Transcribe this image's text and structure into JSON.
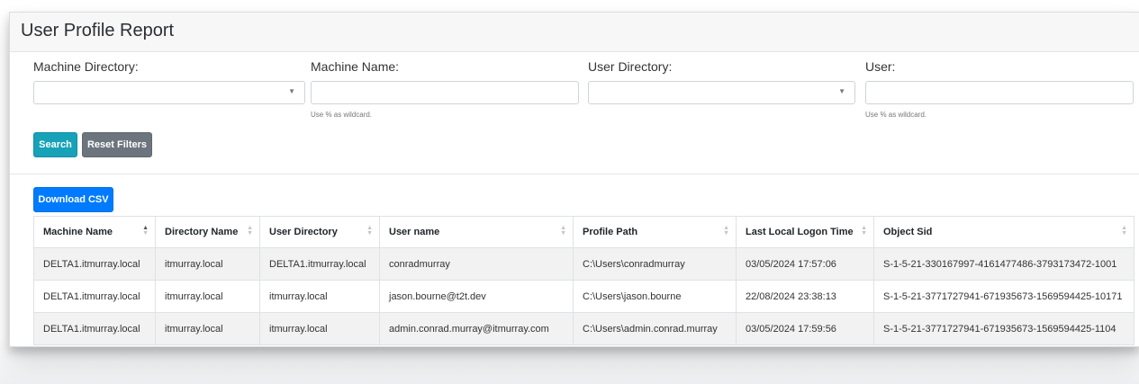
{
  "page": {
    "title": "User Profile Report"
  },
  "filters": {
    "machine_directory": {
      "label": "Machine Directory:",
      "value": ""
    },
    "machine_name": {
      "label": "Machine Name:",
      "value": "",
      "placeholder": "",
      "hint": "Use % as wildcard."
    },
    "user_directory": {
      "label": "User Directory:",
      "value": ""
    },
    "user": {
      "label": "User:",
      "value": "",
      "placeholder": "",
      "hint": "Use % as wildcard."
    }
  },
  "buttons": {
    "search": "Search",
    "reset": "Reset Filters",
    "download": "Download CSV"
  },
  "table": {
    "columns": [
      "Machine Name",
      "Directory Name",
      "User Directory",
      "User name",
      "Profile Path",
      "Last Local Logon Time",
      "Object Sid"
    ],
    "sorted_column": "Machine Name",
    "sort_direction": "ascending",
    "rows": [
      [
        "DELTA1.itmurray.local",
        "itmurray.local",
        "DELTA1.itmurray.local",
        "conradmurray",
        "C:\\Users\\conradmurray",
        "03/05/2024 17:57:06",
        "S-1-5-21-330167997-4161477486-3793173472-1001"
      ],
      [
        "DELTA1.itmurray.local",
        "itmurray.local",
        "itmurray.local",
        "jason.bourne@t2t.dev",
        "C:\\Users\\jason.bourne",
        "22/08/2024 23:38:13",
        "S-1-5-21-3771727941-671935673-1569594425-10171"
      ],
      [
        "DELTA1.itmurray.local",
        "itmurray.local",
        "itmurray.local",
        "admin.conrad.murray@itmurray.com",
        "C:\\Users\\admin.conrad.murray",
        "03/05/2024 17:59:56",
        "S-1-5-21-3771727941-671935673-1569594425-1104"
      ]
    ]
  },
  "colors": {
    "search_button": "#17a2b8",
    "reset_button": "#6c757d",
    "download_button": "#007bff",
    "header_background": "#f7f7f7",
    "striped_row": "#f2f2f2"
  },
  "icons": {
    "select_caret": "caret-down-icon",
    "sort_indicator": "sort-icon"
  }
}
